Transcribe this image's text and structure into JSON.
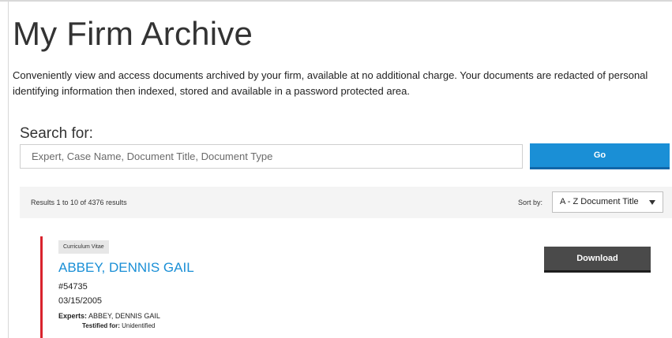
{
  "header": {
    "title": "My Firm Archive",
    "intro": "Conveniently view and access documents archived by your firm, available at no additional charge. Your documents are redacted of personal identifying information then indexed, stored and available in a password protected area."
  },
  "search": {
    "label": "Search for:",
    "value": "",
    "placeholder": "Expert, Case Name, Document Title, Document Type",
    "button_label": "Go"
  },
  "results_bar": {
    "count_text": "Results 1 to 10 of 4376 results",
    "sort_label": "Sort by:",
    "sort_selected": "A - Z Document Title"
  },
  "results": [
    {
      "doc_type": "Curriculum Vitae",
      "title": "ABBEY, DENNIS GAIL",
      "number": "#54735",
      "date": "03/15/2005",
      "experts_label": "Experts:",
      "experts": "ABBEY, DENNIS GAIL",
      "testified_label": "Testified for:",
      "testified_for": "Unidentified",
      "download_label": "Download"
    }
  ],
  "colors": {
    "accent_blue": "#1a8fd6",
    "accent_red": "#d9232d",
    "download_dark": "#4a4a4a",
    "results_bar_bg": "#f4f4f4"
  }
}
